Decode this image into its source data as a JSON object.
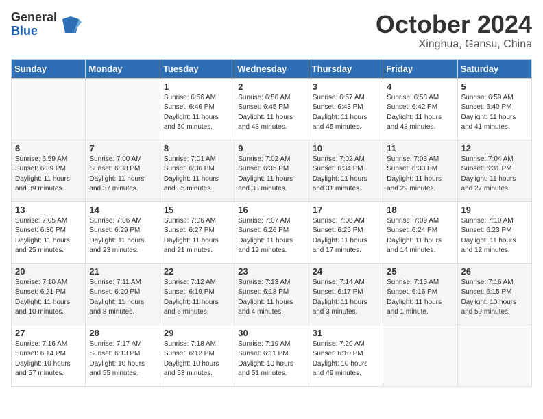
{
  "header": {
    "logo": {
      "general": "General",
      "blue": "Blue"
    },
    "title": "October 2024",
    "location": "Xinghua, Gansu, China"
  },
  "weekdays": [
    "Sunday",
    "Monday",
    "Tuesday",
    "Wednesday",
    "Thursday",
    "Friday",
    "Saturday"
  ],
  "weeks": [
    [
      {
        "day": null
      },
      {
        "day": null
      },
      {
        "day": 1,
        "sunrise": "6:56 AM",
        "sunset": "6:46 PM",
        "daylight": "11 hours and 50 minutes."
      },
      {
        "day": 2,
        "sunrise": "6:56 AM",
        "sunset": "6:45 PM",
        "daylight": "11 hours and 48 minutes."
      },
      {
        "day": 3,
        "sunrise": "6:57 AM",
        "sunset": "6:43 PM",
        "daylight": "11 hours and 45 minutes."
      },
      {
        "day": 4,
        "sunrise": "6:58 AM",
        "sunset": "6:42 PM",
        "daylight": "11 hours and 43 minutes."
      },
      {
        "day": 5,
        "sunrise": "6:59 AM",
        "sunset": "6:40 PM",
        "daylight": "11 hours and 41 minutes."
      }
    ],
    [
      {
        "day": 6,
        "sunrise": "6:59 AM",
        "sunset": "6:39 PM",
        "daylight": "11 hours and 39 minutes."
      },
      {
        "day": 7,
        "sunrise": "7:00 AM",
        "sunset": "6:38 PM",
        "daylight": "11 hours and 37 minutes."
      },
      {
        "day": 8,
        "sunrise": "7:01 AM",
        "sunset": "6:36 PM",
        "daylight": "11 hours and 35 minutes."
      },
      {
        "day": 9,
        "sunrise": "7:02 AM",
        "sunset": "6:35 PM",
        "daylight": "11 hours and 33 minutes."
      },
      {
        "day": 10,
        "sunrise": "7:02 AM",
        "sunset": "6:34 PM",
        "daylight": "11 hours and 31 minutes."
      },
      {
        "day": 11,
        "sunrise": "7:03 AM",
        "sunset": "6:33 PM",
        "daylight": "11 hours and 29 minutes."
      },
      {
        "day": 12,
        "sunrise": "7:04 AM",
        "sunset": "6:31 PM",
        "daylight": "11 hours and 27 minutes."
      }
    ],
    [
      {
        "day": 13,
        "sunrise": "7:05 AM",
        "sunset": "6:30 PM",
        "daylight": "11 hours and 25 minutes."
      },
      {
        "day": 14,
        "sunrise": "7:06 AM",
        "sunset": "6:29 PM",
        "daylight": "11 hours and 23 minutes."
      },
      {
        "day": 15,
        "sunrise": "7:06 AM",
        "sunset": "6:27 PM",
        "daylight": "11 hours and 21 minutes."
      },
      {
        "day": 16,
        "sunrise": "7:07 AM",
        "sunset": "6:26 PM",
        "daylight": "11 hours and 19 minutes."
      },
      {
        "day": 17,
        "sunrise": "7:08 AM",
        "sunset": "6:25 PM",
        "daylight": "11 hours and 17 minutes."
      },
      {
        "day": 18,
        "sunrise": "7:09 AM",
        "sunset": "6:24 PM",
        "daylight": "11 hours and 14 minutes."
      },
      {
        "day": 19,
        "sunrise": "7:10 AM",
        "sunset": "6:23 PM",
        "daylight": "11 hours and 12 minutes."
      }
    ],
    [
      {
        "day": 20,
        "sunrise": "7:10 AM",
        "sunset": "6:21 PM",
        "daylight": "11 hours and 10 minutes."
      },
      {
        "day": 21,
        "sunrise": "7:11 AM",
        "sunset": "6:20 PM",
        "daylight": "11 hours and 8 minutes."
      },
      {
        "day": 22,
        "sunrise": "7:12 AM",
        "sunset": "6:19 PM",
        "daylight": "11 hours and 6 minutes."
      },
      {
        "day": 23,
        "sunrise": "7:13 AM",
        "sunset": "6:18 PM",
        "daylight": "11 hours and 4 minutes."
      },
      {
        "day": 24,
        "sunrise": "7:14 AM",
        "sunset": "6:17 PM",
        "daylight": "11 hours and 3 minutes."
      },
      {
        "day": 25,
        "sunrise": "7:15 AM",
        "sunset": "6:16 PM",
        "daylight": "11 hours and 1 minute."
      },
      {
        "day": 26,
        "sunrise": "7:16 AM",
        "sunset": "6:15 PM",
        "daylight": "10 hours and 59 minutes."
      }
    ],
    [
      {
        "day": 27,
        "sunrise": "7:16 AM",
        "sunset": "6:14 PM",
        "daylight": "10 hours and 57 minutes."
      },
      {
        "day": 28,
        "sunrise": "7:17 AM",
        "sunset": "6:13 PM",
        "daylight": "10 hours and 55 minutes."
      },
      {
        "day": 29,
        "sunrise": "7:18 AM",
        "sunset": "6:12 PM",
        "daylight": "10 hours and 53 minutes."
      },
      {
        "day": 30,
        "sunrise": "7:19 AM",
        "sunset": "6:11 PM",
        "daylight": "10 hours and 51 minutes."
      },
      {
        "day": 31,
        "sunrise": "7:20 AM",
        "sunset": "6:10 PM",
        "daylight": "10 hours and 49 minutes."
      },
      {
        "day": null
      },
      {
        "day": null
      }
    ]
  ]
}
